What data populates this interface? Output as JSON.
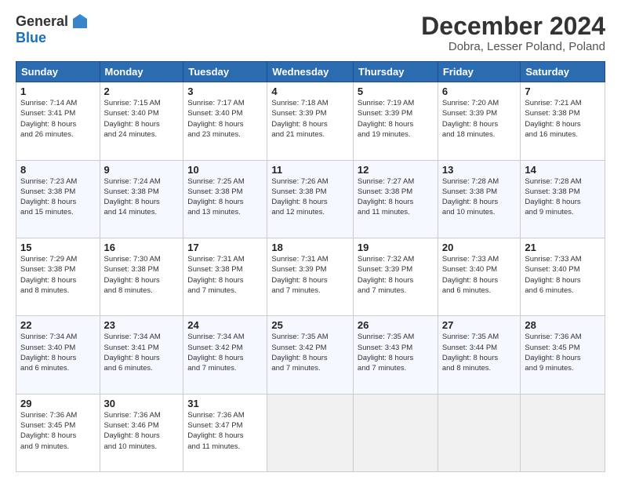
{
  "logo": {
    "general": "General",
    "blue": "Blue"
  },
  "title": "December 2024",
  "location": "Dobra, Lesser Poland, Poland",
  "days_header": [
    "Sunday",
    "Monday",
    "Tuesday",
    "Wednesday",
    "Thursday",
    "Friday",
    "Saturday"
  ],
  "weeks": [
    [
      {
        "day": "1",
        "detail": "Sunrise: 7:14 AM\nSunset: 3:41 PM\nDaylight: 8 hours\nand 26 minutes."
      },
      {
        "day": "2",
        "detail": "Sunrise: 7:15 AM\nSunset: 3:40 PM\nDaylight: 8 hours\nand 24 minutes."
      },
      {
        "day": "3",
        "detail": "Sunrise: 7:17 AM\nSunset: 3:40 PM\nDaylight: 8 hours\nand 23 minutes."
      },
      {
        "day": "4",
        "detail": "Sunrise: 7:18 AM\nSunset: 3:39 PM\nDaylight: 8 hours\nand 21 minutes."
      },
      {
        "day": "5",
        "detail": "Sunrise: 7:19 AM\nSunset: 3:39 PM\nDaylight: 8 hours\nand 19 minutes."
      },
      {
        "day": "6",
        "detail": "Sunrise: 7:20 AM\nSunset: 3:39 PM\nDaylight: 8 hours\nand 18 minutes."
      },
      {
        "day": "7",
        "detail": "Sunrise: 7:21 AM\nSunset: 3:38 PM\nDaylight: 8 hours\nand 16 minutes."
      }
    ],
    [
      {
        "day": "8",
        "detail": "Sunrise: 7:23 AM\nSunset: 3:38 PM\nDaylight: 8 hours\nand 15 minutes."
      },
      {
        "day": "9",
        "detail": "Sunrise: 7:24 AM\nSunset: 3:38 PM\nDaylight: 8 hours\nand 14 minutes."
      },
      {
        "day": "10",
        "detail": "Sunrise: 7:25 AM\nSunset: 3:38 PM\nDaylight: 8 hours\nand 13 minutes."
      },
      {
        "day": "11",
        "detail": "Sunrise: 7:26 AM\nSunset: 3:38 PM\nDaylight: 8 hours\nand 12 minutes."
      },
      {
        "day": "12",
        "detail": "Sunrise: 7:27 AM\nSunset: 3:38 PM\nDaylight: 8 hours\nand 11 minutes."
      },
      {
        "day": "13",
        "detail": "Sunrise: 7:28 AM\nSunset: 3:38 PM\nDaylight: 8 hours\nand 10 minutes."
      },
      {
        "day": "14",
        "detail": "Sunrise: 7:28 AM\nSunset: 3:38 PM\nDaylight: 8 hours\nand 9 minutes."
      }
    ],
    [
      {
        "day": "15",
        "detail": "Sunrise: 7:29 AM\nSunset: 3:38 PM\nDaylight: 8 hours\nand 8 minutes."
      },
      {
        "day": "16",
        "detail": "Sunrise: 7:30 AM\nSunset: 3:38 PM\nDaylight: 8 hours\nand 8 minutes."
      },
      {
        "day": "17",
        "detail": "Sunrise: 7:31 AM\nSunset: 3:38 PM\nDaylight: 8 hours\nand 7 minutes."
      },
      {
        "day": "18",
        "detail": "Sunrise: 7:31 AM\nSunset: 3:39 PM\nDaylight: 8 hours\nand 7 minutes."
      },
      {
        "day": "19",
        "detail": "Sunrise: 7:32 AM\nSunset: 3:39 PM\nDaylight: 8 hours\nand 7 minutes."
      },
      {
        "day": "20",
        "detail": "Sunrise: 7:33 AM\nSunset: 3:40 PM\nDaylight: 8 hours\nand 6 minutes."
      },
      {
        "day": "21",
        "detail": "Sunrise: 7:33 AM\nSunset: 3:40 PM\nDaylight: 8 hours\nand 6 minutes."
      }
    ],
    [
      {
        "day": "22",
        "detail": "Sunrise: 7:34 AM\nSunset: 3:40 PM\nDaylight: 8 hours\nand 6 minutes."
      },
      {
        "day": "23",
        "detail": "Sunrise: 7:34 AM\nSunset: 3:41 PM\nDaylight: 8 hours\nand 6 minutes."
      },
      {
        "day": "24",
        "detail": "Sunrise: 7:34 AM\nSunset: 3:42 PM\nDaylight: 8 hours\nand 7 minutes."
      },
      {
        "day": "25",
        "detail": "Sunrise: 7:35 AM\nSunset: 3:42 PM\nDaylight: 8 hours\nand 7 minutes."
      },
      {
        "day": "26",
        "detail": "Sunrise: 7:35 AM\nSunset: 3:43 PM\nDaylight: 8 hours\nand 7 minutes."
      },
      {
        "day": "27",
        "detail": "Sunrise: 7:35 AM\nSunset: 3:44 PM\nDaylight: 8 hours\nand 8 minutes."
      },
      {
        "day": "28",
        "detail": "Sunrise: 7:36 AM\nSunset: 3:45 PM\nDaylight: 8 hours\nand 9 minutes."
      }
    ],
    [
      {
        "day": "29",
        "detail": "Sunrise: 7:36 AM\nSunset: 3:45 PM\nDaylight: 8 hours\nand 9 minutes."
      },
      {
        "day": "30",
        "detail": "Sunrise: 7:36 AM\nSunset: 3:46 PM\nDaylight: 8 hours\nand 10 minutes."
      },
      {
        "day": "31",
        "detail": "Sunrise: 7:36 AM\nSunset: 3:47 PM\nDaylight: 8 hours\nand 11 minutes."
      },
      null,
      null,
      null,
      null
    ]
  ]
}
